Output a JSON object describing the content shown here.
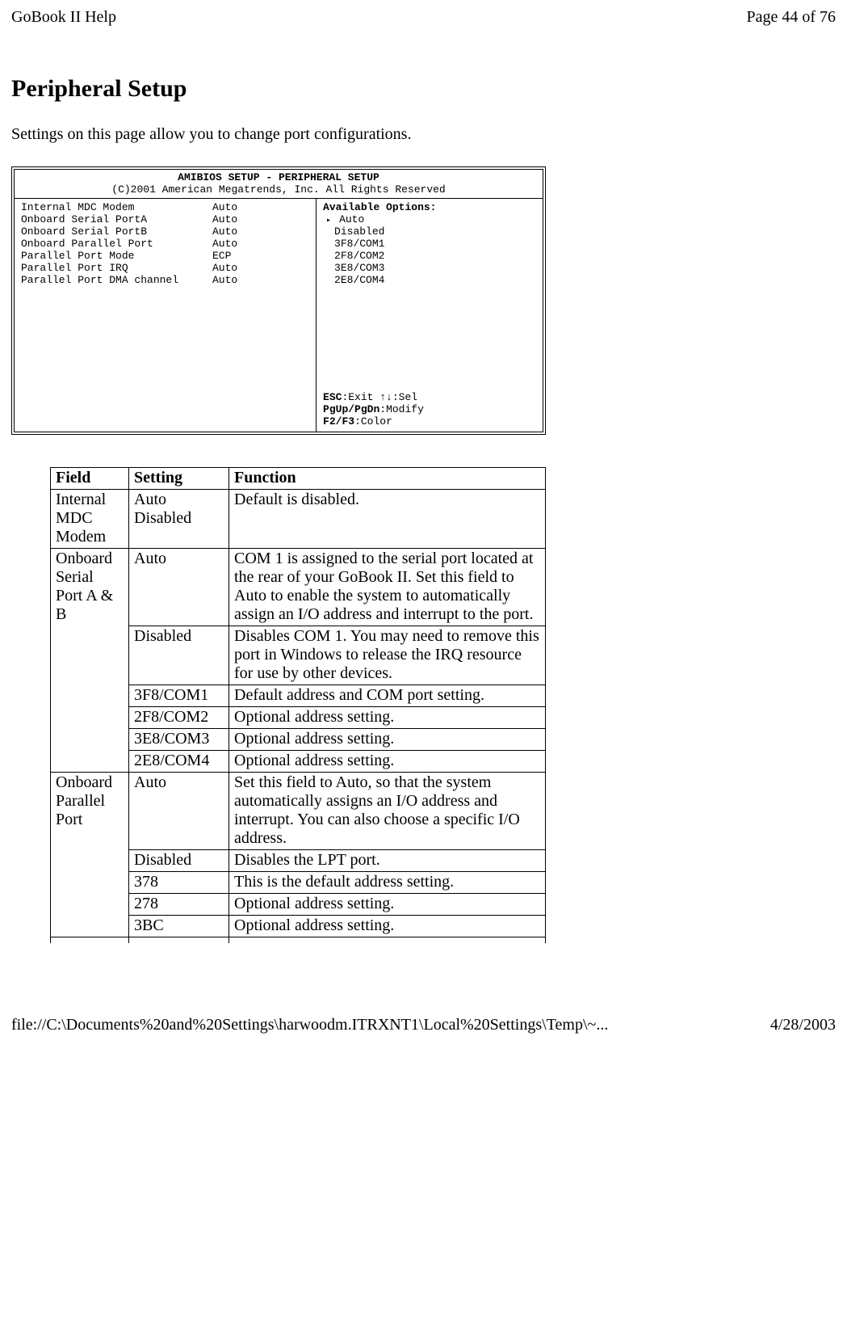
{
  "header": {
    "left": "GoBook II Help",
    "right": "Page 44 of 76"
  },
  "title": "Peripheral Setup",
  "intro": "Settings on this page allow you to change port configurations.",
  "bios": {
    "title": "AMIBIOS SETUP - PERIPHERAL SETUP",
    "subtitle": "(C)2001 American Megatrends, Inc. All Rights Reserved",
    "settings": [
      {
        "label": "Internal MDC Modem",
        "value": "Auto"
      },
      {
        "label": "Onboard Serial PortA",
        "value": "Auto"
      },
      {
        "label": "Onboard Serial PortB",
        "value": "Auto"
      },
      {
        "label": "Onboard Parallel Port",
        "value": "Auto"
      },
      {
        "label": "Parallel Port Mode",
        "value": "ECP"
      },
      {
        "label": "Parallel Port IRQ",
        "value": "Auto"
      },
      {
        "label": "Parallel Port DMA channel",
        "value": "Auto"
      }
    ],
    "options_header": "Available Options:",
    "options": [
      {
        "text": "Auto",
        "selected": true
      },
      {
        "text": "Disabled",
        "selected": false
      },
      {
        "text": "3F8/COM1",
        "selected": false
      },
      {
        "text": "2F8/COM2",
        "selected": false
      },
      {
        "text": "3E8/COM3",
        "selected": false
      },
      {
        "text": "2E8/COM4",
        "selected": false
      }
    ],
    "help": {
      "l1a": "ESC",
      "l1b": ":Exit  ",
      "l1c": "↑↓",
      "l1d": ":Sel",
      "l2a": "PgUp/PgDn",
      "l2b": ":Modify",
      "l3a": "F2/F3",
      "l3b": ":Color"
    }
  },
  "table": {
    "headers": {
      "field": "Field",
      "setting": "Setting",
      "function": "Function"
    },
    "rows": [
      {
        "field": "Internal MDC Modem",
        "setting": "Auto Disabled",
        "function": "Default is disabled."
      },
      {
        "field": "Onboard Serial Port A & B",
        "rowspan": 6,
        "setting": "Auto",
        "function": "COM 1 is assigned to the serial port located at the rear of your GoBook II.  Set this field to Auto to enable the system to automatically assign an I/O address and interrupt to the port."
      },
      {
        "setting": "Disabled",
        "function": "Disables COM 1.  You may need to remove this port in Windows to release the IRQ resource for use by other devices."
      },
      {
        "setting": "3F8/COM1",
        "function": "Default address and COM port setting."
      },
      {
        "setting": "2F8/COM2",
        "function": "Optional address setting."
      },
      {
        "setting": "3E8/COM3",
        "function": "Optional address setting."
      },
      {
        "setting": "2E8/COM4",
        "function": "Optional address setting."
      },
      {
        "field": "Onboard Parallel Port",
        "rowspan": 5,
        "setting": "Auto",
        "function": "Set this field to Auto, so that the system automatically assigns an I/O address and interrupt.  You can also choose a specific I/O address."
      },
      {
        "setting": "Disabled",
        "function": "Disables the LPT port."
      },
      {
        "setting": "378",
        "function": "This is the default address setting."
      },
      {
        "setting": "278",
        "function": "Optional address setting."
      },
      {
        "setting": "3BC",
        "function": "Optional address setting."
      }
    ]
  },
  "footer": {
    "left": "file://C:\\Documents%20and%20Settings\\harwoodm.ITRXNT1\\Local%20Settings\\Temp\\~...",
    "right": "4/28/2003"
  }
}
